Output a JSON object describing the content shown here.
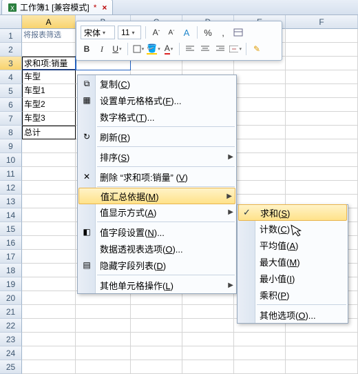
{
  "tab": {
    "title": "工作簿1 [兼容模式]",
    "dirty": "*"
  },
  "toolbar": {
    "font_name": "宋体",
    "font_size": "11",
    "btn_grow": "A",
    "btn_shrink": "A",
    "btn_clearfmt": "A",
    "btn_percent": "%",
    "btn_comma": ",",
    "btn_bold": "B",
    "btn_italic": "I",
    "btn_underline": "U",
    "btn_fontcolor": "A"
  },
  "columns": [
    "A",
    "B",
    "C",
    "D",
    "E",
    "F"
  ],
  "rows_count": 25,
  "cells": {
    "A1": "将报表筛选",
    "A3": "求和项:销量",
    "A4": "车型",
    "A5": "车型1",
    "A6": "车型2",
    "A7": "车型3",
    "A8": "总计"
  },
  "menu1": [
    {
      "label": "复制",
      "accel": "C",
      "icon": "copy"
    },
    {
      "label": "设置单元格格式",
      "accel": "F",
      "suffix": "...",
      "icon": "fmt"
    },
    {
      "label": "数字格式",
      "accel": "T",
      "suffix": "..."
    },
    {
      "sep": true
    },
    {
      "label": "刷新",
      "accel": "R",
      "icon": "refresh"
    },
    {
      "sep": true
    },
    {
      "label": "排序",
      "accel": "S",
      "submenu": true
    },
    {
      "sep": true
    },
    {
      "label": "删除 “求和项:销量” ",
      "accel": "V",
      "icon": "x"
    },
    {
      "sep": true
    },
    {
      "label": "值汇总依据",
      "accel": "M",
      "submenu": true,
      "hover": true
    },
    {
      "label": "值显示方式",
      "accel": "A",
      "submenu": true
    },
    {
      "sep": true
    },
    {
      "label": "值字段设置",
      "accel": "N",
      "suffix": "...",
      "icon": "vf"
    },
    {
      "label": "数据透视表选项",
      "accel": "O",
      "suffix": "..."
    },
    {
      "label": "隐藏字段列表",
      "accel": "D",
      "icon": "list"
    },
    {
      "sep": true
    },
    {
      "label": "其他单元格操作",
      "accel": "L",
      "submenu": true
    }
  ],
  "menu2": [
    {
      "label": "求和",
      "accel": "S",
      "checked": true,
      "hover": true
    },
    {
      "label": "计数",
      "accel": "C"
    },
    {
      "label": "平均值",
      "accel": "A"
    },
    {
      "label": "最大值",
      "accel": "M"
    },
    {
      "label": "最小值",
      "accel": "I"
    },
    {
      "label": "乘积",
      "accel": "P"
    },
    {
      "sep": true
    },
    {
      "label": "其他选项",
      "accel": "O",
      "suffix": "..."
    }
  ],
  "chart_data": null
}
